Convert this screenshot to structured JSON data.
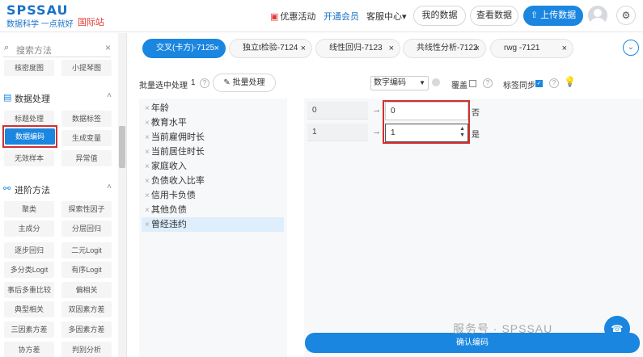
{
  "header": {
    "logo": "SPSSAU",
    "tagline": "数据科学 一点就好",
    "intl": "国际站",
    "nav": {
      "promo": "优惠活动",
      "vip": "开通会员",
      "service": "客服中心",
      "service_caret": "▾"
    },
    "my_data": "我的数据",
    "view_data": "查看数据",
    "upload": "上传数据",
    "upload_icon": "⇧",
    "settings_icon": "⚙"
  },
  "sidebar": {
    "search_placeholder": "搜索方法",
    "top_items": [
      "核密度图",
      "小提琴图"
    ],
    "data_processing": {
      "title": "数据处理",
      "items": [
        "标题处理",
        "数据标签",
        "数据编码",
        "生成变量",
        "无效样本",
        "异常值"
      ],
      "selected_index": 2
    },
    "advanced": {
      "title": "进阶方法",
      "items": [
        "聚类",
        "探索性因子",
        "主成分",
        "分层回归",
        "逐步回归",
        "二元Logit",
        "多分类Logit",
        "有序Logit",
        "事后多重比较",
        "偏相关",
        "典型相关",
        "双因素方差",
        "三因素方差",
        "多因素方差",
        "协方差",
        "判别分析"
      ]
    }
  },
  "tabs": [
    {
      "label": "交叉(卡方)-7125",
      "active": true
    },
    {
      "label": "独立t检验-7124",
      "active": false
    },
    {
      "label": "线性回归-7123",
      "active": false
    },
    {
      "label": "共线性分析-7122",
      "active": false
    },
    {
      "label": "rwg -7121",
      "active": false
    }
  ],
  "toolbar": {
    "batch_label": "批量选中处理",
    "batch_count": "1",
    "batch_button": "批量处理",
    "encode_select": "数字编码",
    "overwrite_label": "覆盖",
    "label_sync": "标签同步"
  },
  "variables": [
    "年龄",
    "教育水平",
    "当前雇佣时长",
    "当前居住时长",
    "家庭收入",
    "负债收入比率",
    "信用卡负债",
    "其他负债",
    "曾经违约"
  ],
  "selected_variable": "曾经违约",
  "mapping": [
    {
      "from": "0",
      "to": "0",
      "label": "否"
    },
    {
      "from": "1",
      "to": "1",
      "label": "是"
    }
  ],
  "confirm_button": "确认编码",
  "watermark": "服务号 · SPSSAU",
  "colors": {
    "primary": "#1a86e0",
    "highlight": "#d32f2f",
    "intl": "#e53935"
  }
}
